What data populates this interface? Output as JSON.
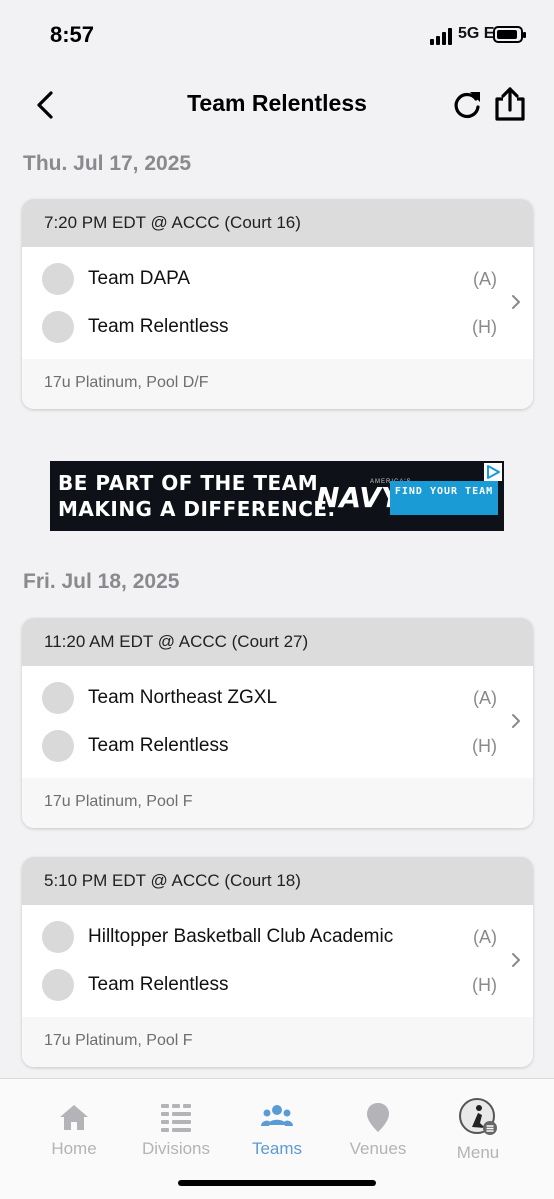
{
  "status_bar": {
    "time": "8:57",
    "network": "5G E"
  },
  "nav": {
    "title": "Team Relentless"
  },
  "days": [
    {
      "date": "Thu. Jul 17, 2025",
      "games": [
        {
          "header": "7:20 PM EDT @ ACCC (Court 16)",
          "team_a": "Team DAPA",
          "team_a_side": "(A)",
          "team_h": "Team Relentless",
          "team_h_side": "(H)",
          "footer": "17u Platinum, Pool D/F"
        }
      ]
    },
    {
      "date": "Fri. Jul 18, 2025",
      "games": [
        {
          "header": "11:20 AM EDT @ ACCC (Court 27)",
          "team_a": "Team Northeast ZGXL",
          "team_a_side": "(A)",
          "team_h": "Team Relentless",
          "team_h_side": "(H)",
          "footer": "17u Platinum, Pool F"
        },
        {
          "header": "5:10 PM EDT @ ACCC (Court 18)",
          "team_a": "Hilltopper Basketball Club Academic",
          "team_a_side": "(A)",
          "team_h": "Team Relentless",
          "team_h_side": "(H)",
          "footer": "17u Platinum, Pool F"
        }
      ]
    }
  ],
  "ad": {
    "line1": "BE PART OF THE TEAM",
    "line2": "MAKING A DIFFERENCE.",
    "brand_small": "AMERICA'S",
    "brand": "NAVY",
    "cta": "FIND YOUR TEAM"
  },
  "tabs": [
    {
      "label": "Home",
      "icon": "home-icon"
    },
    {
      "label": "Divisions",
      "icon": "divisions-icon"
    },
    {
      "label": "Teams",
      "icon": "teams-icon",
      "active": true
    },
    {
      "label": "Venues",
      "icon": "venues-icon"
    },
    {
      "label": "Menu",
      "icon": "menu-avatar-icon"
    }
  ],
  "colors": {
    "accent": "#5b9bd5",
    "inactive": "#b4b4b8",
    "card_header": "#dcdcdc",
    "background": "#f2f2f4"
  }
}
